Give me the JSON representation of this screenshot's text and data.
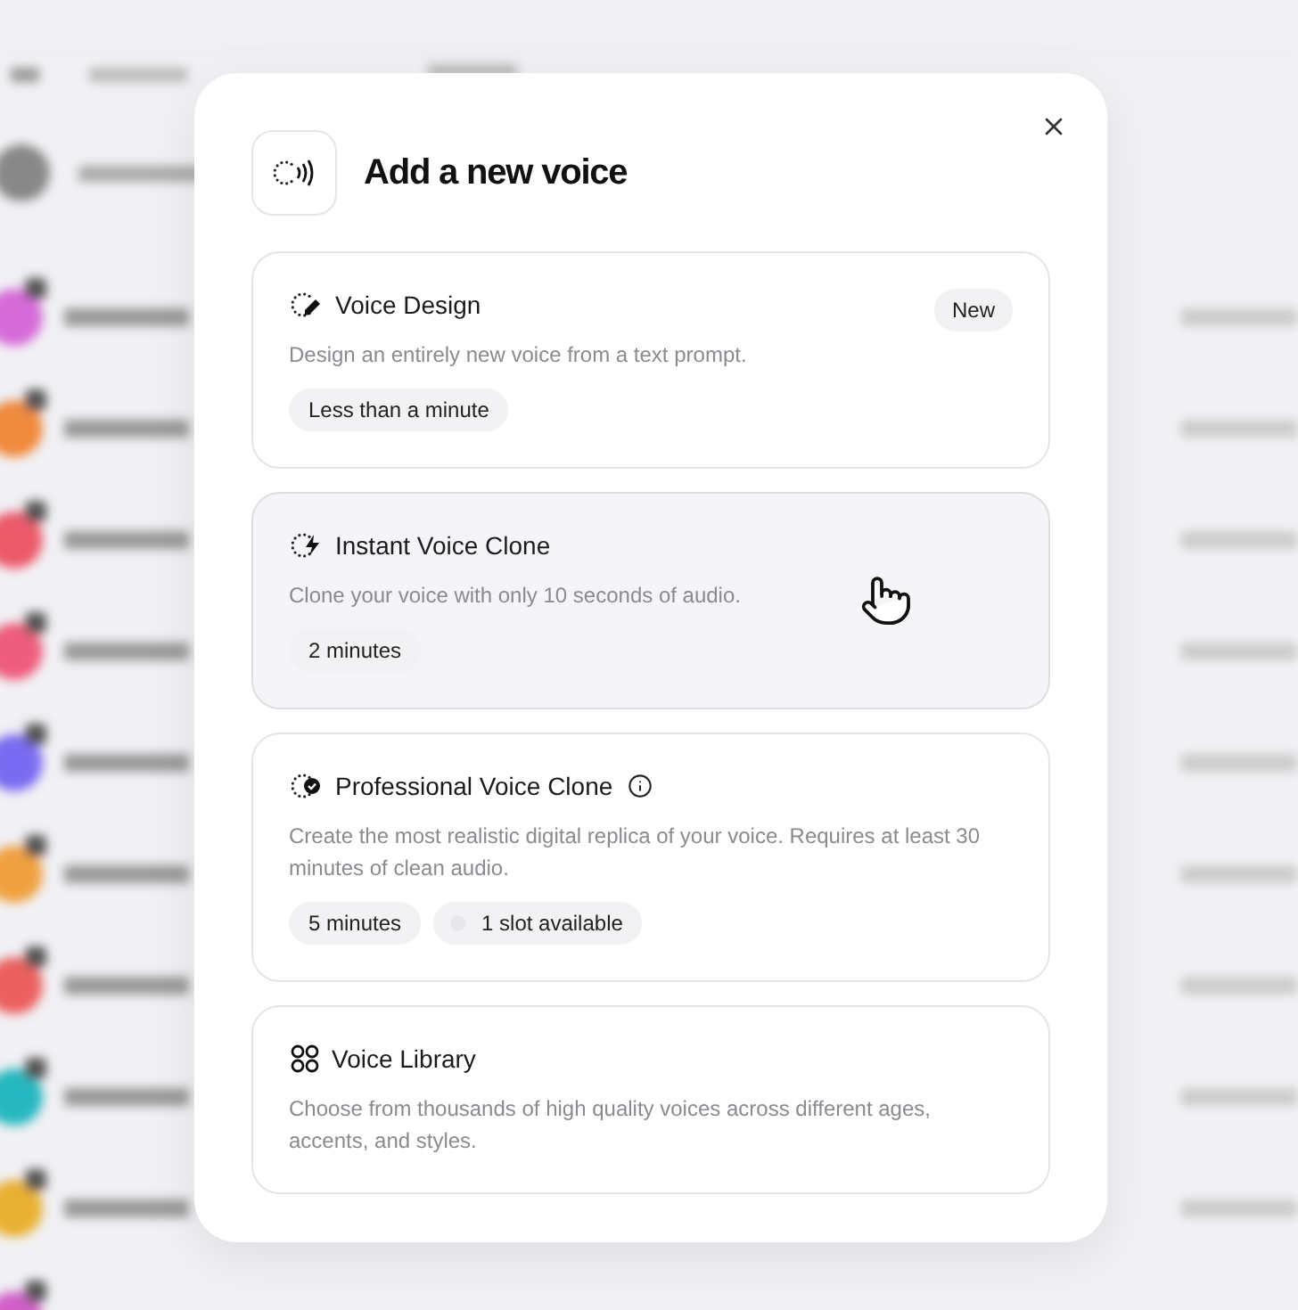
{
  "dialog": {
    "title": "Add a new voice",
    "options": [
      {
        "kind": "design",
        "title": "Voice Design",
        "badge": "New",
        "description": "Design an entirely new voice from a text prompt.",
        "chips": [
          "Less than a minute"
        ],
        "info": false,
        "hovered": false
      },
      {
        "kind": "instant",
        "title": "Instant Voice Clone",
        "description": "Clone your voice with only 10 seconds of audio.",
        "chips": [
          "2 minutes"
        ],
        "info": false,
        "hovered": true
      },
      {
        "kind": "professional",
        "title": "Professional Voice Clone",
        "description": "Create the most realistic digital replica of your voice. Requires at least 30 minutes of clean audio.",
        "chips": [
          "5 minutes"
        ],
        "slot": "1 slot available",
        "info": true,
        "hovered": false
      },
      {
        "kind": "library",
        "title": "Voice Library",
        "description": "Choose from thousands of high quality voices across different ages, accents, and styles.",
        "info": false,
        "hovered": false
      }
    ]
  }
}
